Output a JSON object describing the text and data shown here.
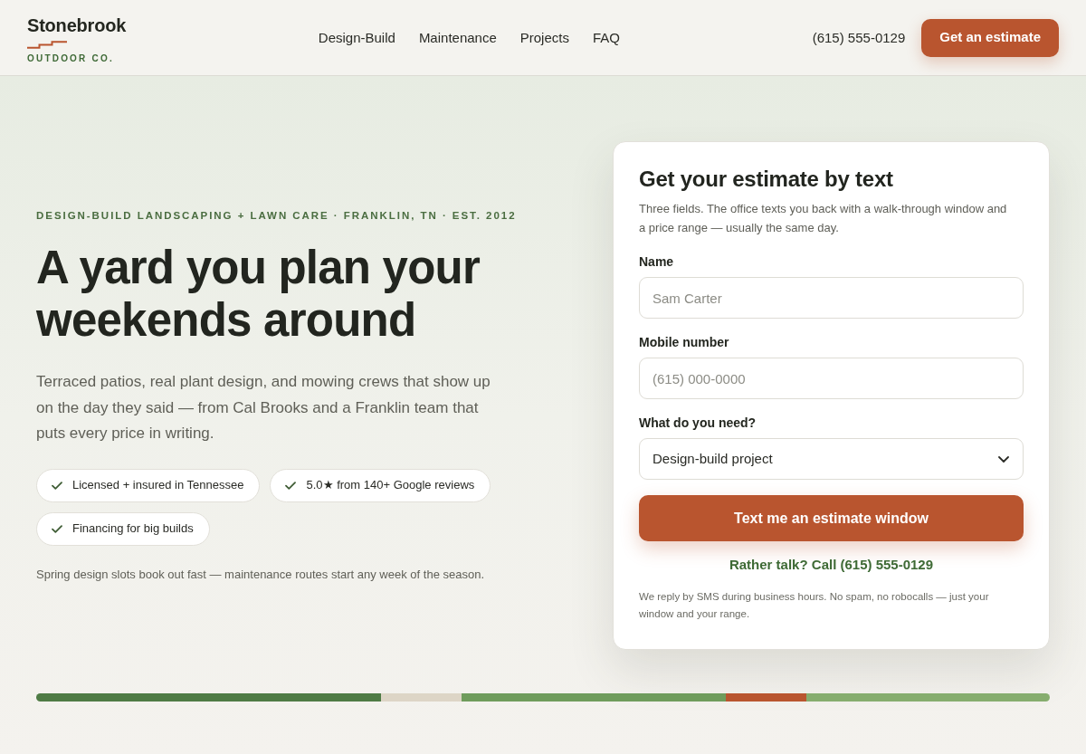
{
  "header": {
    "brand": {
      "name": "Stonebrook",
      "tagline": "OUTDOOR CO."
    },
    "nav": [
      "Design-Build",
      "Maintenance",
      "Projects",
      "FAQ"
    ],
    "phone": "(615) 555-0129",
    "cta_button": "Get an estimate"
  },
  "hero": {
    "eyebrow": "DESIGN-BUILD LANDSCAPING + LAWN CARE · FRANKLIN, TN · EST. 2012",
    "headline": "A yard you plan your weekends around",
    "intro": "Terraced patios, real plant design, and mowing crews that show up on the day they said — from Cal Brooks and a Franklin team that puts every price in writing.",
    "badges": [
      "Licensed + insured in Tennessee",
      "5.0★ from 140+ Google reviews",
      "Financing for big builds"
    ],
    "note": "Spring design slots book out fast — maintenance routes start any week of the season."
  },
  "estimate_form": {
    "title": "Get your estimate by text",
    "subtitle": "Three fields. The office texts you back with a walk-through window and a price range — usually the same day.",
    "fields": [
      {
        "kind": "input",
        "label": "Name",
        "placeholder": "Sam Carter"
      },
      {
        "kind": "input",
        "label": "Mobile number",
        "placeholder": "(615) 000-0000"
      },
      {
        "kind": "select",
        "label": "What do you need?",
        "value": "Design-build project"
      }
    ],
    "submit_button": "Text me an estimate window",
    "call_link": "Rather talk? Call (615) 555-0129",
    "disclaimer": "We reply by SMS during business hours. No spam, no robocalls — just your window and your range."
  }
}
